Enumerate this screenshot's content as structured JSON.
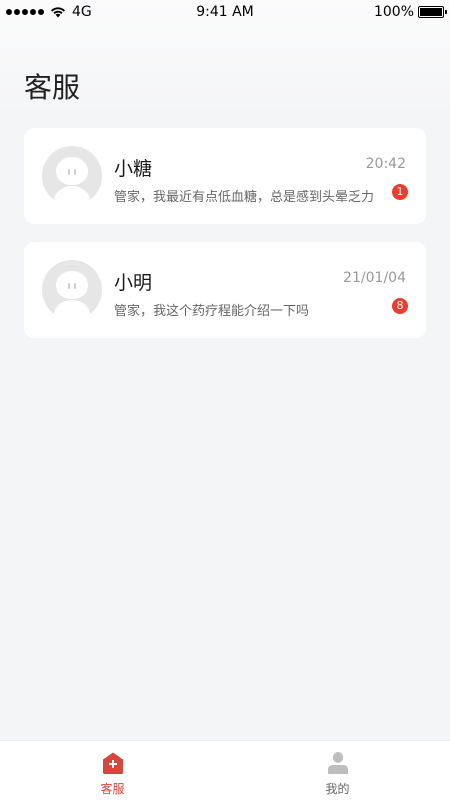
{
  "status_bar": {
    "carrier": "4G",
    "time": "9:41 AM",
    "battery": "100%",
    "battery_level": 1.0
  },
  "header": {
    "title": "客服"
  },
  "conversations": [
    {
      "name": "小糖",
      "time": "20:42",
      "preview": "管家，我最近有点低血糖，总是感到头晕乏力",
      "unread": "1"
    },
    {
      "name": "小明",
      "time": "21/01/04",
      "preview": "管家，我这个药疗程能介绍一下吗",
      "unread": "8"
    }
  ],
  "tabbar": {
    "tabs": [
      {
        "label": "客服",
        "icon": "service-home-icon",
        "active": true
      },
      {
        "label": "我的",
        "icon": "user-icon",
        "active": false
      }
    ]
  },
  "colors": {
    "accent": "#d8453a",
    "badge": "#ee3b2b",
    "inactive_icon": "#bdbdbd"
  }
}
